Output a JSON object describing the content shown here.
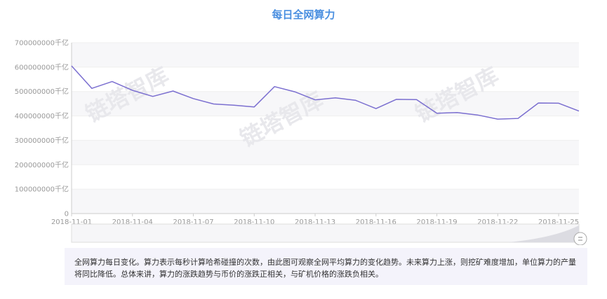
{
  "chart_data": {
    "type": "line",
    "title": "每日全网算力",
    "x": [
      "2018-11-01",
      "2018-11-02",
      "2018-11-03",
      "2018-11-04",
      "2018-11-05",
      "2018-11-06",
      "2018-11-07",
      "2018-11-08",
      "2018-11-09",
      "2018-11-10",
      "2018-11-11",
      "2018-11-12",
      "2018-11-13",
      "2018-11-14",
      "2018-11-15",
      "2018-11-16",
      "2018-11-17",
      "2018-11-18",
      "2018-11-19",
      "2018-11-20",
      "2018-11-21",
      "2018-11-22",
      "2018-11-23",
      "2018-11-24",
      "2018-11-25",
      "2018-11-26"
    ],
    "x_tick_labels": [
      "2018-11-01",
      "2018-11-04",
      "2018-11-07",
      "2018-11-10",
      "2018-11-13",
      "2018-11-16",
      "2018-11-19",
      "2018-11-22",
      "2018-11-25"
    ],
    "series": [
      {
        "values": [
          605000000,
          513000000,
          541000000,
          505000000,
          480000000,
          502000000,
          471000000,
          449000000,
          444000000,
          437000000,
          520000000,
          499000000,
          466000000,
          474000000,
          464000000,
          430000000,
          468000000,
          467000000,
          411000000,
          414000000,
          404000000,
          387000000,
          390000000,
          453000000,
          452000000,
          420000000
        ],
        "color": "#7b6fd0"
      }
    ],
    "ylim": [
      0,
      700000000
    ],
    "y_ticks": [
      0,
      100000000,
      200000000,
      300000000,
      400000000,
      500000000,
      600000000,
      700000000
    ],
    "y_tick_labels": [
      "0",
      "100000000千亿",
      "200000000千亿",
      "300000000千亿",
      "400000000千亿",
      "500000000千亿",
      "600000000千亿",
      "700000000千亿"
    ],
    "grid": true,
    "legend": "none",
    "band_colors": [
      "#ffffff",
      "#f7f7f9"
    ],
    "axis_color": "#cccccc",
    "watermark": "链塔智库"
  },
  "description": "全网算力每日变化。算力表示每秒计算哈希碰撞的次数，由此图可观察全网平均算力的变化趋势。未来算力上涨，则挖矿难度增加，单位算力的产量将同比降低。总体来讲，算力的涨跌趋势与币价的涨跌正相关，与矿机价格的涨跌负相关。"
}
